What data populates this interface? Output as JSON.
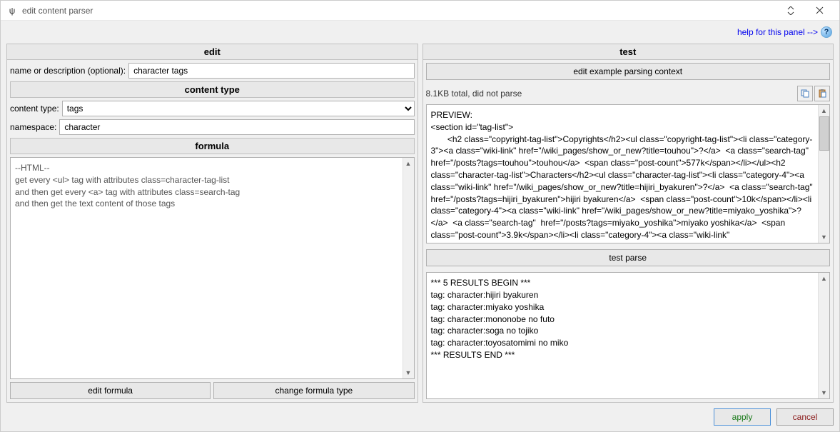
{
  "window": {
    "icon_glyph": "ψ",
    "title": "edit content parser"
  },
  "help_link": "help for this panel -->",
  "left": {
    "title": "edit",
    "name_label": "name or description (optional):",
    "name_value": "character tags",
    "ct_header": "content type",
    "ct_label": "content type:",
    "ct_value": "tags",
    "ns_label": "namespace:",
    "ns_value": "character",
    "formula_header": "formula",
    "formula_text": "--HTML--\nget every <ul> tag with attributes class=character-tag-list\nand then get every <a> tag with attributes class=search-tag\nand then get the text content of those tags",
    "edit_formula_btn": "edit formula",
    "change_type_btn": "change formula type"
  },
  "right": {
    "title": "test",
    "edit_ctx_btn": "edit example parsing context",
    "status": "8.1KB total, did not parse",
    "preview_text": "PREVIEW:\n<section id=\"tag-list\">\n       <h2 class=\"copyright-tag-list\">Copyrights</h2><ul class=\"copyright-tag-list\"><li class=\"category-3\"><a class=\"wiki-link\" href=\"/wiki_pages/show_or_new?title=touhou\">?</a>  <a class=\"search-tag\"  href=\"/posts?tags=touhou\">touhou</a>  <span class=\"post-count\">577k</span></li></ul><h2 class=\"character-tag-list\">Characters</h2><ul class=\"character-tag-list\"><li class=\"category-4\"><a class=\"wiki-link\" href=\"/wiki_pages/show_or_new?title=hijiri_byakuren\">?</a>  <a class=\"search-tag\"  href=\"/posts?tags=hijiri_byakuren\">hijiri byakuren</a>  <span class=\"post-count\">10k</span></li><li class=\"category-4\"><a class=\"wiki-link\" href=\"/wiki_pages/show_or_new?title=miyako_yoshika\">?</a>  <a class=\"search-tag\"  href=\"/posts?tags=miyako_yoshika\">miyako yoshika</a>  <span class=\"post-count\">3.9k</span></li><li class=\"category-4\"><a class=\"wiki-link\"",
    "test_parse_btn": "test parse",
    "results_text": "*** 5 RESULTS BEGIN ***\ntag: character:hijiri byakuren\ntag: character:miyako yoshika\ntag: character:mononobe no futo\ntag: character:soga no tojiko\ntag: character:toyosatomimi no miko\n*** RESULTS END ***"
  },
  "footer": {
    "apply": "apply",
    "cancel": "cancel"
  }
}
